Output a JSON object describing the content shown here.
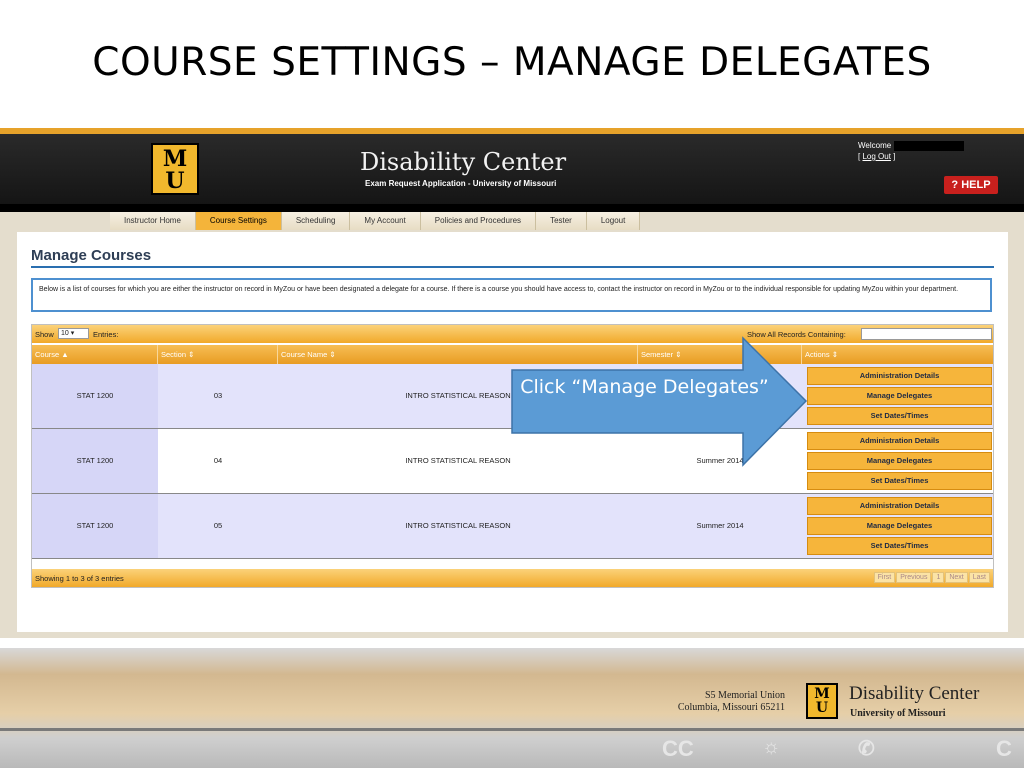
{
  "slide": {
    "title": "COURSE SETTINGS – MANAGE DELEGATES"
  },
  "app": {
    "logo": "MU",
    "title": "Disability Center",
    "subtitle": "Exam Request Application - University of Missouri",
    "welcome": "Welcome",
    "logout_open": "[",
    "logout_label": "Log Out",
    "logout_close": "]",
    "help_label": "HELP",
    "help_icon": "question-mark-icon"
  },
  "nav": {
    "items": [
      "Instructor Home",
      "Course Settings",
      "Scheduling",
      "My Account",
      "Policies and Procedures",
      "Tester",
      "Logout"
    ],
    "active": "Course Settings"
  },
  "page": {
    "heading": "Manage Courses",
    "info": "Below is a list of courses for which you are either the instructor on record in MyZou or have been designated a delegate for a course. If there is a course you should have access to, contact the instructor on record in MyZou or to the individual responsible for updating MyZou within your department."
  },
  "table": {
    "show_label": "Show",
    "show_value": "10",
    "entries_label": "Entries:",
    "search_label": "Show All Records Containing:",
    "search_value": "",
    "columns": [
      "Course",
      "Section",
      "Course Name",
      "Semester",
      "Actions"
    ],
    "rows": [
      {
        "course": "STAT 1200",
        "section": "03",
        "course_name": "INTRO STATISTICAL REASON",
        "semester": ""
      },
      {
        "course": "STAT 1200",
        "section": "04",
        "course_name": "INTRO STATISTICAL REASON",
        "semester": "Summer 2014"
      },
      {
        "course": "STAT 1200",
        "section": "05",
        "course_name": "INTRO STATISTICAL REASON",
        "semester": "Summer 2014"
      }
    ],
    "actions": [
      "Administration Details",
      "Manage Delegates",
      "Set Dates/Times"
    ],
    "footer_info": "Showing 1 to 3 of 3 entries",
    "pager": [
      "First",
      "Previous",
      "1",
      "Next",
      "Last"
    ]
  },
  "callout": {
    "text": "Click “Manage Delegates”"
  },
  "footer": {
    "address_line1": "S5 Memorial Union",
    "address_line2": "Columbia, Missouri 65211",
    "org_name": "Disability Center",
    "university": "University of Missouri",
    "icons": [
      "closed-caption-icon",
      "hearing-icon",
      "phone-volume-icon"
    ]
  },
  "colors": {
    "gold": "#f1b82d",
    "accent_orange": "#f6b53b",
    "callout_blue": "#5b9bd5",
    "help_red": "#c8201d"
  }
}
